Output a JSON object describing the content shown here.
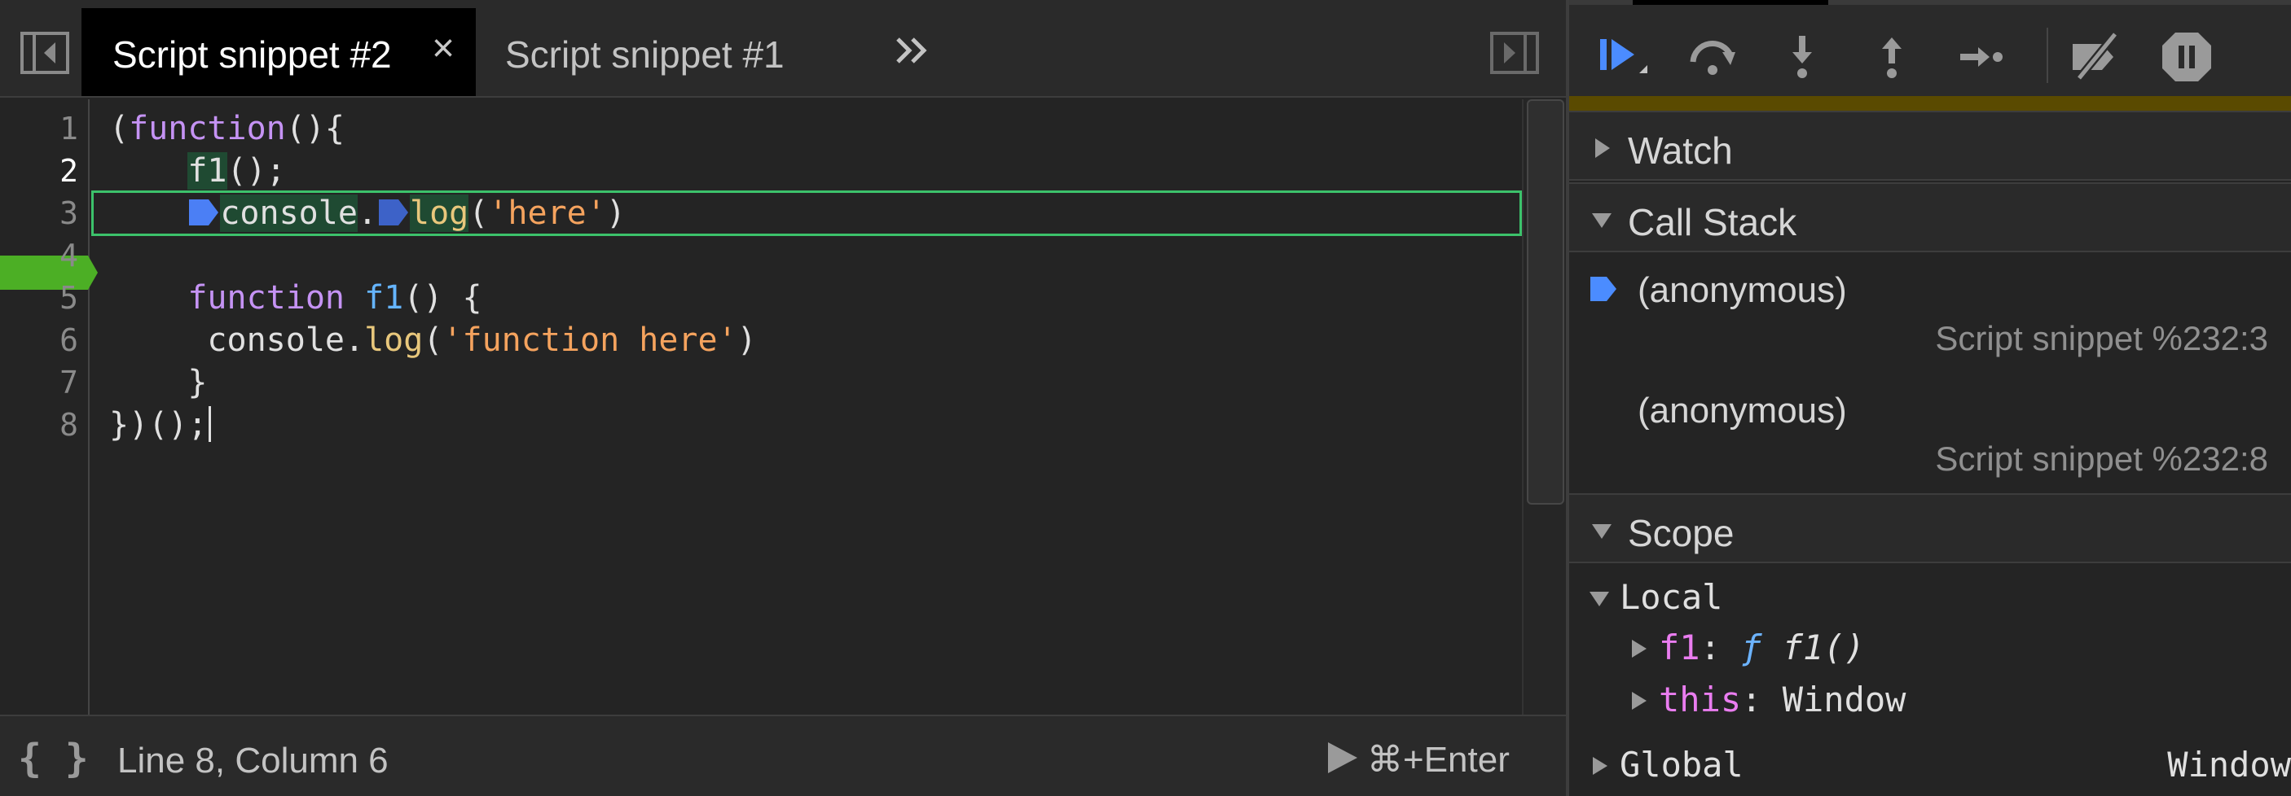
{
  "editor": {
    "tabs": [
      {
        "label": "Script snippet #2",
        "active": true
      },
      {
        "label": "Script snippet #1",
        "active": false
      }
    ],
    "tab_close_glyph": "×",
    "more_tabs_icon": "double-chevron-right-icon",
    "line_numbers": [
      "1",
      "2",
      "3",
      "4",
      "5",
      "6",
      "7",
      "8"
    ],
    "breakpoint_line": 2,
    "execution_line": 3,
    "code": {
      "l1_open": "(",
      "l1_kw": "function",
      "l1_rest": "(){",
      "l2_indent": "    ",
      "l2_call": "f1",
      "l2_rest": "();",
      "l3_indent": "    ",
      "l3_obj": "console",
      "l3_dot": ".",
      "l3_method": "log",
      "l3_open": "(",
      "l3_str": "'here'",
      "l3_close": ")",
      "l5_indent": "    ",
      "l5_kw": "function",
      "l5_space": " ",
      "l5_name": "f1",
      "l5_rest": "() {",
      "l6_indent": "     ",
      "l6_obj": "console.",
      "l6_method": "log",
      "l6_open": "(",
      "l6_str": "'function here'",
      "l6_close": ")",
      "l7_text": "    }",
      "l8_text": "})();"
    },
    "status": {
      "pretty_print_label": "{ }",
      "cursor_position": "Line 8, Column 6",
      "run_label": "⌘+Enter"
    }
  },
  "debugger": {
    "toolbar_icons": [
      "resume-icon",
      "step-over-icon",
      "step-into-icon",
      "step-out-icon",
      "step-icon",
      "deactivate-breakpoints-icon",
      "pause-on-exceptions-icon"
    ],
    "sections": {
      "watch": "Watch",
      "call_stack": "Call Stack",
      "scope": "Scope"
    },
    "call_stack": [
      {
        "name": "(anonymous)",
        "location": "Script snippet %232:3",
        "current": true
      },
      {
        "name": "(anonymous)",
        "location": "Script snippet %232:8",
        "current": false
      }
    ],
    "scope": {
      "local_label": "Local",
      "local_props": [
        {
          "key": "f1",
          "sep": ": ",
          "fsym": "ƒ",
          "value": " f1()"
        },
        {
          "key": "this",
          "sep": ": ",
          "value": "Window"
        }
      ],
      "global_label": "Global",
      "global_value": "Window"
    }
  },
  "colors": {
    "accent_blue": "#4b8cff",
    "breakpoint_green": "#4caf25",
    "exec_line_border": "#3cc26b",
    "keyword": "#c593f4",
    "string": "#f5a35e",
    "property": "#ea7df0"
  }
}
